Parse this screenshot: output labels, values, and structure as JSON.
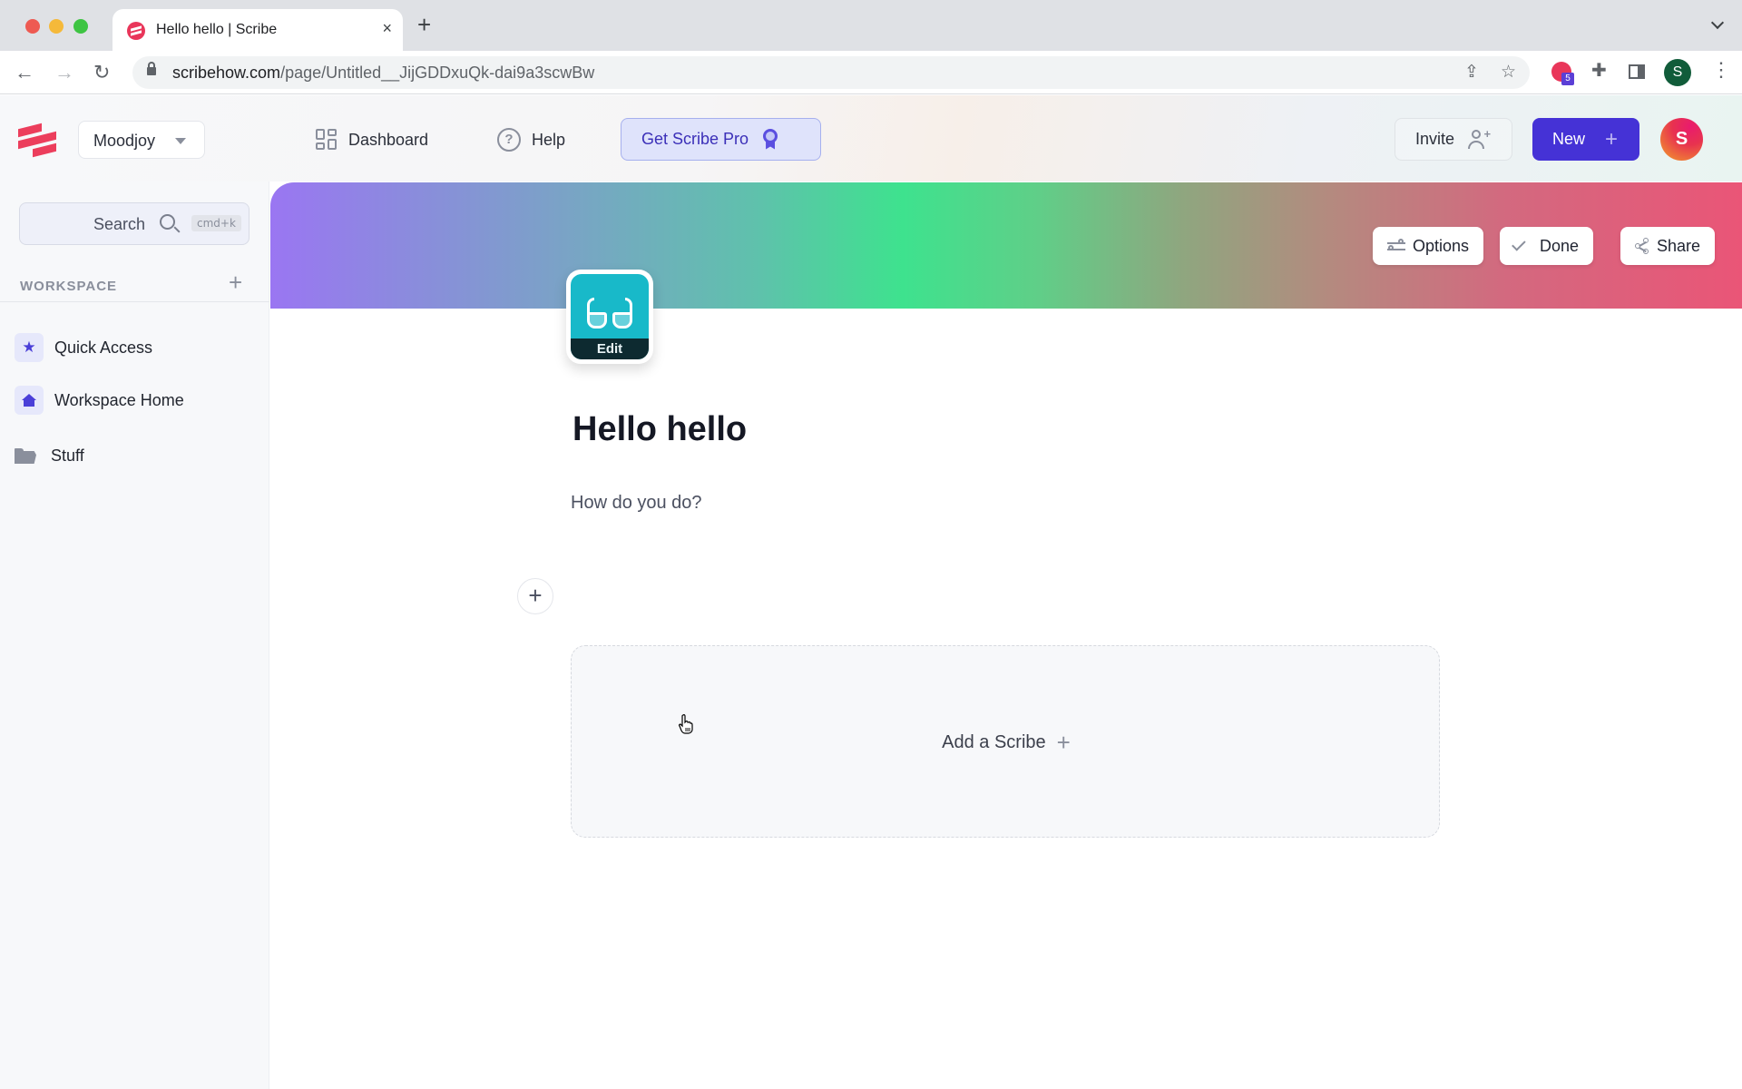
{
  "browser": {
    "tab_title": "Hello hello | Scribe",
    "tab_close": "×",
    "new_tab": "+",
    "url_host": "scribehow.com",
    "url_path": "/page/Untitled__JijGDDxuQk-dai9a3scwBw",
    "extension_badge": "5",
    "profile_initial": "S",
    "icons": [
      "back-arrow",
      "forward-arrow",
      "reload",
      "lock",
      "share",
      "bookmark-star",
      "scribe-extension",
      "puzzle-extension",
      "side-panel",
      "profile",
      "more-menu"
    ]
  },
  "header": {
    "workspace_name": "Moodjoy",
    "nav": [
      {
        "label": "Dashboard",
        "icon": "dashboard-icon"
      },
      {
        "label": "Help",
        "icon": "help-icon"
      }
    ],
    "pro_button": "Get Scribe Pro",
    "invite_button": "Invite",
    "new_button": "New",
    "avatar_initial": "S",
    "colors": {
      "brand_red": "#ec3e5c",
      "primary": "#4532d6",
      "pro_bg": "#dfe3fb"
    }
  },
  "sidebar": {
    "search_label": "Search",
    "search_shortcut": "cmd+k",
    "section_label": "WORKSPACE",
    "items": [
      {
        "label": "Quick Access",
        "icon": "star-icon"
      },
      {
        "label": "Workspace Home",
        "icon": "home-icon"
      },
      {
        "label": "Stuff",
        "icon": "folder-icon"
      }
    ]
  },
  "page": {
    "banner_buttons": {
      "options": "Options",
      "done": "Done",
      "share": "Share"
    },
    "icon_edit_label": "Edit",
    "title": "Hello hello",
    "description": "How do you do?",
    "add_block": "+",
    "add_scribe_label": "Add a Scribe"
  }
}
